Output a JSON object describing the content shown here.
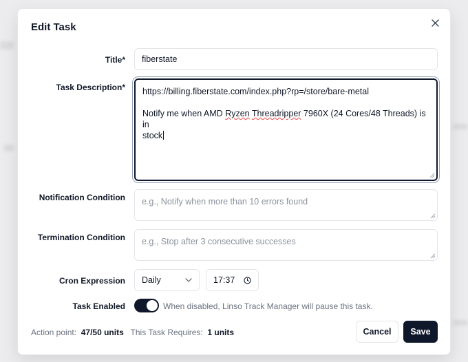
{
  "dialog": {
    "title": "Edit Task"
  },
  "form": {
    "title_label": "Title*",
    "title_value": "fiberstate",
    "description_label": "Task Description*",
    "description_line1": "https://billing.fiberstate.com/index.php?rp=/store/bare-metal",
    "description_line2_a": "Notify me when AMD ",
    "description_line2_misspelled": "Ryzen",
    "description_line2_b": " ",
    "description_line2_misspelled2": "Threadripper",
    "description_line2_c": " 7960X (24 Cores/48 Threads) is in",
    "description_line3": "stock",
    "notification_label": "Notification Condition",
    "notification_placeholder": "e.g., Notify when more than 10 errors found",
    "termination_label": "Termination Condition",
    "termination_placeholder": "e.g., Stop after 3 consecutive successes",
    "cron_label": "Cron Expression",
    "cron_frequency": "Daily",
    "cron_time": "17:37",
    "enabled_label": "Task Enabled",
    "enabled": true,
    "enabled_hint": "When disabled, Linso Track Manager will pause this task."
  },
  "footer": {
    "action_point_label": "Action point:",
    "action_point_value": "47/50 units",
    "requires_label": "This Task Requires:",
    "requires_value": "1 units",
    "cancel_label": "Cancel",
    "save_label": "Save"
  },
  "icons": {
    "close": "close-icon",
    "chevron": "chevron-down-icon",
    "clock": "clock-icon"
  },
  "colors": {
    "primary": "#0f172a",
    "muted_text": "#6b7280",
    "border": "#e3e5e9"
  }
}
